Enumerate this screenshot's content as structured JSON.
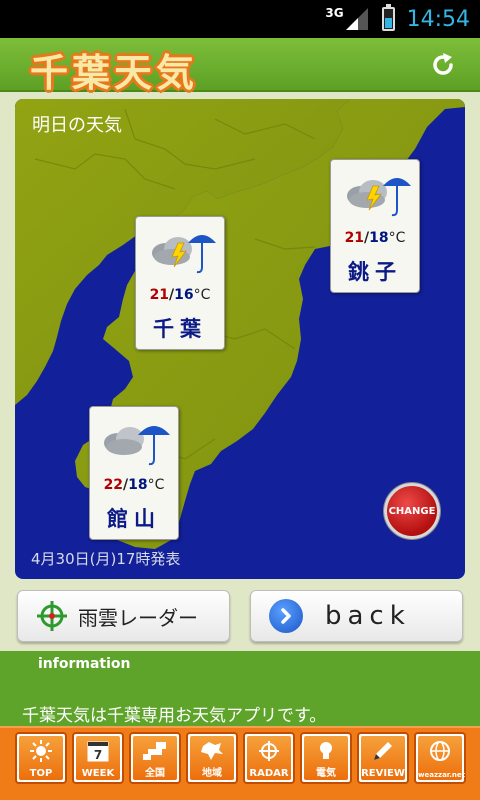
{
  "status_bar": {
    "network": "3G",
    "time": "14:54"
  },
  "header": {
    "title": "千葉天気",
    "refresh_icon": "refresh-icon"
  },
  "map": {
    "heading": "明日の天気",
    "footnote": "4月30日(月)17時発表",
    "change_label": "CHANGE",
    "cards": [
      {
        "city": "銚子",
        "high": "21",
        "low": "18",
        "unit": "°C",
        "icon": "cloud-thunder-rain-icon"
      },
      {
        "city": "千葉",
        "high": "21",
        "low": "16",
        "unit": "°C",
        "icon": "cloud-thunder-rain-icon"
      },
      {
        "city": "館山",
        "high": "22",
        "low": "18",
        "unit": "°C",
        "icon": "cloud-rain-icon"
      }
    ]
  },
  "buttons": {
    "radar_label": "雨雲レーダー",
    "back_label": "back"
  },
  "info": {
    "title": "information",
    "text": "千葉天気は千葉専用お天気アプリです。"
  },
  "nav": [
    {
      "label": "TOP",
      "icon": "sun-icon"
    },
    {
      "label": "WEEK",
      "icon": "calendar-icon",
      "number": "7"
    },
    {
      "label": "全国",
      "icon": "japan-map-icon"
    },
    {
      "label": "地域",
      "icon": "region-map-icon"
    },
    {
      "label": "RADAR",
      "icon": "radar-icon"
    },
    {
      "label": "電気",
      "icon": "lightbulb-icon"
    },
    {
      "label": "REVIEW",
      "icon": "pencil-icon"
    },
    {
      "label": "weazzar.net",
      "icon": "globe-icon"
    }
  ],
  "colors": {
    "header_green": "#6cb030",
    "map_sea": "#12209a",
    "land": "#8c9e13",
    "nav_orange": "#f07c18",
    "high_temp": "#b00000",
    "low_temp": "#00167f"
  }
}
